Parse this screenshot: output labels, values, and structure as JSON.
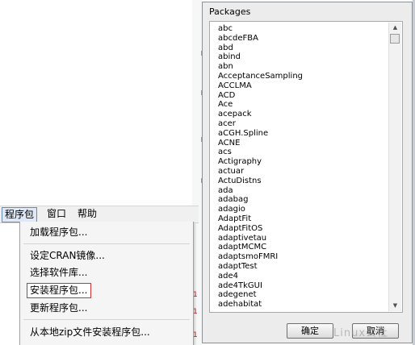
{
  "menubar": {
    "items": [
      {
        "label": "程序包"
      },
      {
        "label": "窗口"
      },
      {
        "label": "帮助"
      }
    ]
  },
  "dropdown": {
    "items": [
      {
        "label": "加载程序包..."
      },
      {
        "label": "设定CRAN镜像..."
      },
      {
        "label": "选择软件库..."
      },
      {
        "label": "安装程序包..."
      },
      {
        "label": "更新程序包..."
      },
      {
        "label": "从本地zip文件安装程序包..."
      }
    ]
  },
  "dialog": {
    "title": "Packages",
    "packages": [
      "abc",
      "abcdeFBA",
      "abd",
      "abind",
      "abn",
      "AcceptanceSampling",
      "ACCLMA",
      "ACD",
      "Ace",
      "acepack",
      "acer",
      "aCGH.Spline",
      "ACNE",
      "acs",
      "Actigraphy",
      "actuar",
      "ActuDistns",
      "ada",
      "adabag",
      "adagio",
      "AdaptFit",
      "AdaptFitOS",
      "adaptivetau",
      "adaptMCMC",
      "adaptsmoFMRI",
      "adaptTest",
      "ade4",
      "ade4TkGUI",
      "adegenet",
      "adehabitat"
    ],
    "ok_label": "确定",
    "cancel_label": "取消",
    "selected_index": 0
  },
  "background": {
    "marks": [
      "1",
      "1",
      "1"
    ]
  },
  "watermark": "Linux公社",
  "colors": {
    "highlight_border": "#d03030",
    "menu_active": "#dfe8f6"
  }
}
